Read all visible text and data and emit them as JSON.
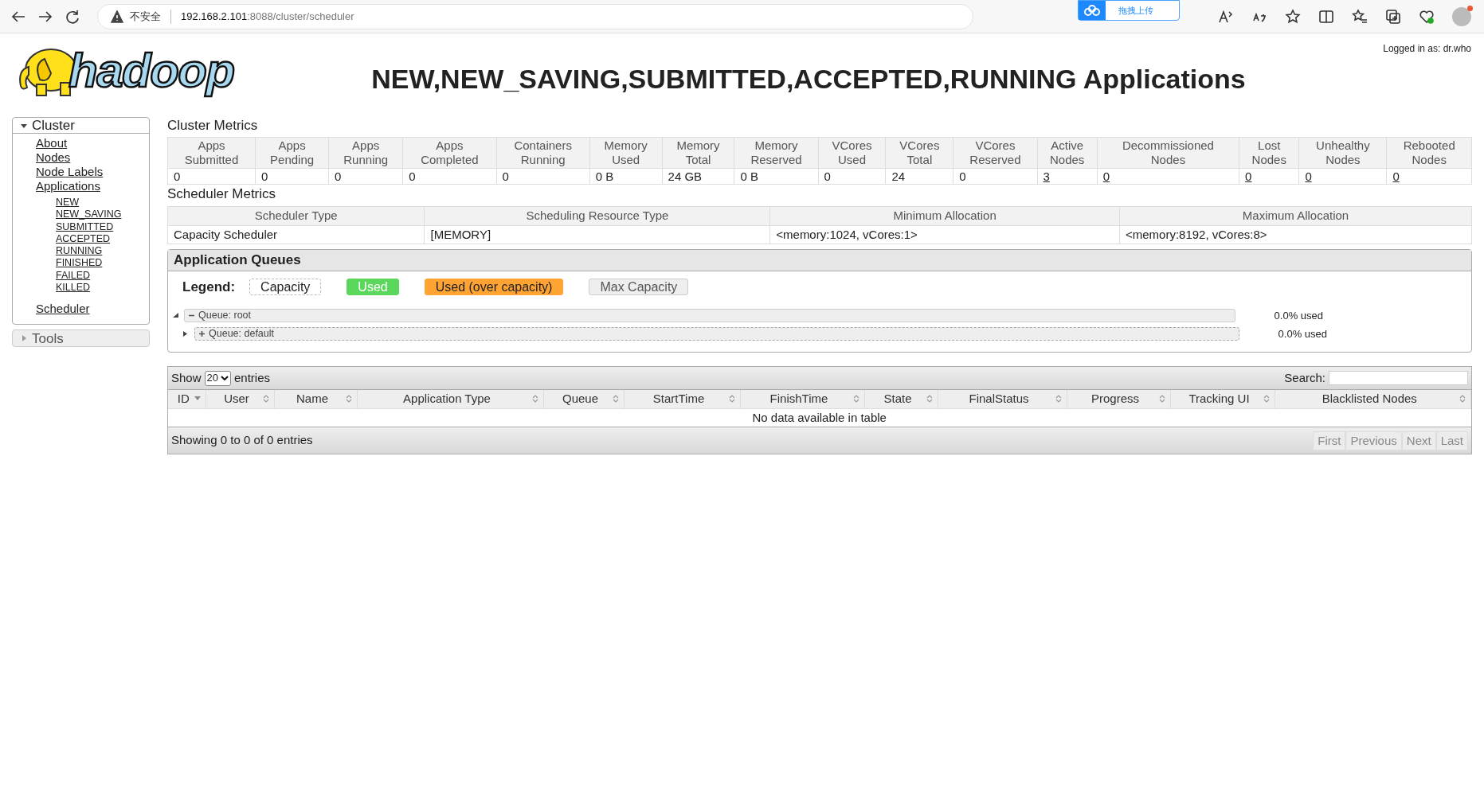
{
  "browser": {
    "security_label": "不安全",
    "url_host": "192.168.2.101",
    "url_path": ":8088/cluster/scheduler",
    "extension_label": "拖拽上传"
  },
  "header": {
    "logo_text": "hadoop",
    "logged_in": "Logged in as: dr.who",
    "title": "NEW,NEW_SAVING,SUBMITTED,ACCEPTED,RUNNING Applications"
  },
  "sidebar": [
    {
      "label": "Cluster",
      "expanded": true,
      "children": [
        {
          "label": "About"
        },
        {
          "label": "Nodes"
        },
        {
          "label": "Node Labels"
        },
        {
          "label": "Applications",
          "children": [
            {
              "label": "NEW"
            },
            {
              "label": "NEW_SAVING"
            },
            {
              "label": "SUBMITTED"
            },
            {
              "label": "ACCEPTED"
            },
            {
              "label": "RUNNING"
            },
            {
              "label": "FINISHED"
            },
            {
              "label": "FAILED"
            },
            {
              "label": "KILLED"
            }
          ]
        },
        {
          "label": "Scheduler"
        }
      ]
    },
    {
      "label": "Tools",
      "expanded": false
    }
  ],
  "cluster_metrics": {
    "title": "Cluster Metrics",
    "columns": [
      "Apps Submitted",
      "Apps Pending",
      "Apps Running",
      "Apps Completed",
      "Containers Running",
      "Memory Used",
      "Memory Total",
      "Memory Reserved",
      "VCores Used",
      "VCores Total",
      "VCores Reserved",
      "Active Nodes",
      "Decommissioned Nodes",
      "Lost Nodes",
      "Unhealthy Nodes",
      "Rebooted Nodes"
    ],
    "row": [
      {
        "text": "0",
        "link": false
      },
      {
        "text": "0",
        "link": false
      },
      {
        "text": "0",
        "link": false
      },
      {
        "text": "0",
        "link": false
      },
      {
        "text": "0",
        "link": false
      },
      {
        "text": "0 B",
        "link": false
      },
      {
        "text": "24 GB",
        "link": false
      },
      {
        "text": "0 B",
        "link": false
      },
      {
        "text": "0",
        "link": false
      },
      {
        "text": "24",
        "link": false
      },
      {
        "text": "0",
        "link": false
      },
      {
        "text": "3",
        "link": true
      },
      {
        "text": "0",
        "link": true
      },
      {
        "text": "0",
        "link": true
      },
      {
        "text": "0",
        "link": true
      },
      {
        "text": "0",
        "link": true
      }
    ]
  },
  "scheduler_metrics": {
    "title": "Scheduler Metrics",
    "columns": [
      "Scheduler Type",
      "Scheduling Resource Type",
      "Minimum Allocation",
      "Maximum Allocation"
    ],
    "row": [
      "Capacity Scheduler",
      "[MEMORY]",
      "<memory:1024, vCores:1>",
      "<memory:8192, vCores:8>"
    ]
  },
  "queues": {
    "title": "Application Queues",
    "legend_label": "Legend:",
    "legend": [
      {
        "label": "Capacity",
        "kind": "capacity"
      },
      {
        "label": "Used",
        "kind": "used"
      },
      {
        "label": "Used (over capacity)",
        "kind": "over"
      },
      {
        "label": "Max Capacity",
        "kind": "max"
      }
    ],
    "tree": [
      {
        "label": "Queue: root",
        "expanded": true,
        "reading": "0.0% used",
        "children": [
          {
            "label": "Queue: default",
            "expanded": false,
            "reading": "0.0% used"
          }
        ]
      }
    ]
  },
  "applications": {
    "show_label": "Show",
    "page_size": "20",
    "entries_label": "entries",
    "search_label": "Search:",
    "columns": [
      {
        "label": "ID",
        "sorted": true
      },
      {
        "label": "User",
        "sorted": false
      },
      {
        "label": "Name",
        "sorted": false
      },
      {
        "label": "Application Type",
        "sorted": false
      },
      {
        "label": "Queue",
        "sorted": false
      },
      {
        "label": "StartTime",
        "sorted": false
      },
      {
        "label": "FinishTime",
        "sorted": false
      },
      {
        "label": "State",
        "sorted": false
      },
      {
        "label": "FinalStatus",
        "sorted": false
      },
      {
        "label": "Progress",
        "sorted": false
      },
      {
        "label": "Tracking UI",
        "sorted": false
      },
      {
        "label": "Blacklisted Nodes",
        "sorted": false
      }
    ],
    "empty_message": "No data available in table",
    "info": "Showing 0 to 0 of 0 entries",
    "pager": [
      {
        "label": "First",
        "disabled": true
      },
      {
        "label": "Previous",
        "disabled": true
      },
      {
        "label": "Next",
        "disabled": true
      },
      {
        "label": "Last",
        "disabled": true
      }
    ]
  }
}
